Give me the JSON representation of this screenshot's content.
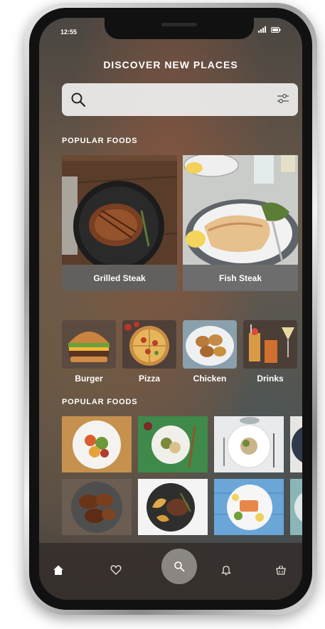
{
  "status": {
    "time": "12:55"
  },
  "header": {
    "title": "DISCOVER NEW PLACES"
  },
  "search": {
    "placeholder": "",
    "value": ""
  },
  "sections": [
    {
      "title": "POPULAR FOODS"
    },
    {
      "title": "POPULAR FOODS"
    }
  ],
  "featured": [
    {
      "label": "Grilled Steak"
    },
    {
      "label": "Fish Steak"
    }
  ],
  "categories": [
    {
      "label": "Burger"
    },
    {
      "label": "Pizza"
    },
    {
      "label": "Chicken"
    },
    {
      "label": "Drinks"
    }
  ],
  "tabbar": {
    "active": "home",
    "items": [
      "home-icon",
      "heart-icon",
      "search-icon",
      "bell-icon",
      "basket-icon"
    ]
  }
}
